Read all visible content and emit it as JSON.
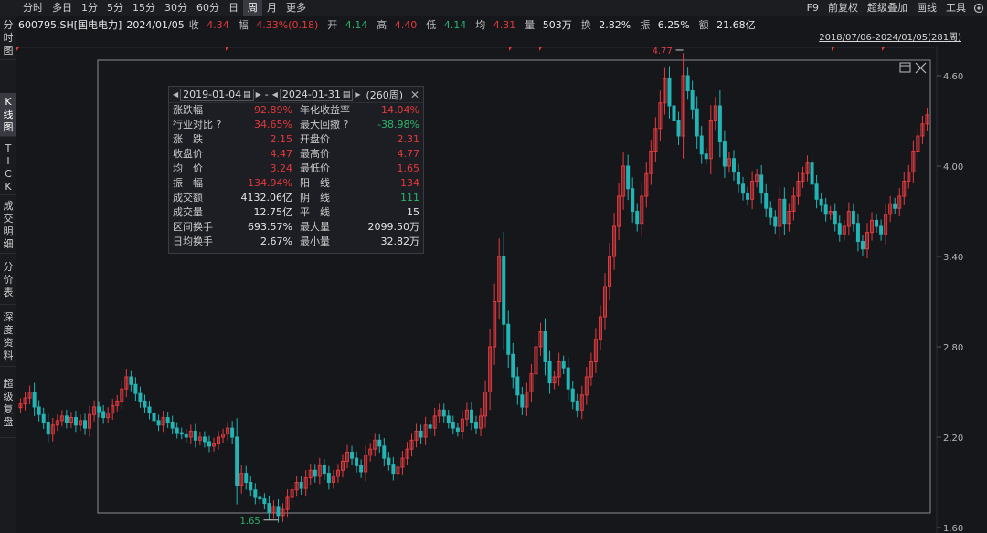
{
  "toolbar": {
    "tabs": [
      {
        "label": "分时",
        "active": false
      },
      {
        "label": "多日",
        "active": false
      },
      {
        "label": "1分",
        "active": false
      },
      {
        "label": "5分",
        "active": false
      },
      {
        "label": "15分",
        "active": false
      },
      {
        "label": "30分",
        "active": false
      },
      {
        "label": "60分",
        "active": false
      },
      {
        "label": "日",
        "active": false
      },
      {
        "label": "周",
        "active": true
      },
      {
        "label": "月",
        "active": false
      },
      {
        "label": "更多",
        "active": false
      }
    ],
    "right_items": [
      "F9",
      "前复权",
      "超级叠加",
      "画线",
      "工具"
    ]
  },
  "quote": {
    "code": "600795.SH[国电电力]",
    "date": "2024/01/05",
    "close_label": "收",
    "close": "4.34",
    "change_label": "幅",
    "change": "4.33%(0.18)",
    "open_label": "开",
    "open": "4.14",
    "high_label": "高",
    "high": "4.40",
    "low_label": "低",
    "low": "4.14",
    "avg_label": "均",
    "avg": "4.31",
    "volume_label": "量",
    "volume": "503万",
    "turnover_label": "换",
    "turnover": "2.82%",
    "amplitude_label": "振",
    "amplitude": "6.25%",
    "amount_label": "额",
    "amount": "21.68亿"
  },
  "sidebar": [
    {
      "chars": [
        "分",
        "时",
        "图"
      ],
      "active": false
    },
    {
      "chars": [
        "K",
        "线",
        "图"
      ],
      "active": true
    },
    {
      "chars": [
        "T",
        "I",
        "C",
        "K"
      ],
      "active": false
    },
    {
      "chars": [
        "成",
        "交",
        "明",
        "细"
      ],
      "active": false
    },
    {
      "chars": [
        "分",
        "价",
        "表"
      ],
      "active": false
    },
    {
      "chars": [
        "深",
        "度",
        "资",
        "料"
      ],
      "active": false
    },
    {
      "chars": [
        "超",
        "级",
        "复",
        "盘"
      ],
      "active": false
    }
  ],
  "range_label": "2018/07/06-2024/01/05(281周)",
  "panel": {
    "start_date": "2019-01-04",
    "separator": "-",
    "end_date": "2024-01-31",
    "weeks": "(260周)",
    "rows": [
      [
        {
          "k": "涨跌幅",
          "v": "92.89%",
          "c": "up"
        },
        {
          "k": "年化收益率",
          "v": "14.04%",
          "c": "up"
        }
      ],
      [
        {
          "k": "行业对比 ?",
          "v": "34.65%",
          "c": "up"
        },
        {
          "k": "最大回撤 ?",
          "v": "-38.98%",
          "c": "down"
        }
      ],
      [
        {
          "k": "涨　跌",
          "v": "2.15",
          "c": "up"
        },
        {
          "k": "开盘价",
          "v": "2.31",
          "c": "up"
        }
      ],
      [
        {
          "k": "收盘价",
          "v": "4.47",
          "c": "up"
        },
        {
          "k": "最高价",
          "v": "4.77",
          "c": "up"
        }
      ],
      [
        {
          "k": "均　价",
          "v": "3.24",
          "c": "up"
        },
        {
          "k": "最低价",
          "v": "1.65",
          "c": "up"
        }
      ],
      [
        {
          "k": "振　幅",
          "v": "134.94%",
          "c": "up"
        },
        {
          "k": "阳　线",
          "v": "134",
          "c": "up"
        }
      ],
      [
        {
          "k": "成交额",
          "v": "4132.06亿",
          "c": "white"
        },
        {
          "k": "阴　线",
          "v": "111",
          "c": "down"
        }
      ],
      [
        {
          "k": "成交量",
          "v": "12.75亿",
          "c": "white"
        },
        {
          "k": "平　线",
          "v": "15",
          "c": "white"
        }
      ],
      [
        {
          "k": "区间换手",
          "v": "693.57%",
          "c": "white"
        },
        {
          "k": "最大量",
          "v": "2099.50万",
          "c": "white"
        }
      ],
      [
        {
          "k": "日均换手",
          "v": "2.67%",
          "c": "white"
        },
        {
          "k": "最小量",
          "v": "32.82万",
          "c": "white"
        }
      ]
    ]
  },
  "chart_data": {
    "type": "candlestick",
    "y_ticks": [
      4.6,
      4.0,
      3.4,
      2.8,
      2.2,
      1.6
    ],
    "ylim": [
      1.6,
      4.8
    ],
    "max_label": "4.77",
    "min_label": "1.65",
    "up_color": "#e23a3f",
    "down_color": "#22b5b5",
    "closes": [
      2.42,
      2.46,
      2.5,
      2.4,
      2.35,
      2.3,
      2.22,
      2.28,
      2.31,
      2.34,
      2.3,
      2.33,
      2.28,
      2.31,
      2.26,
      2.35,
      2.4,
      2.37,
      2.33,
      2.36,
      2.41,
      2.44,
      2.52,
      2.6,
      2.55,
      2.49,
      2.44,
      2.4,
      2.36,
      2.31,
      2.28,
      2.33,
      2.3,
      2.26,
      2.23,
      2.22,
      2.2,
      2.24,
      2.18,
      2.2,
      2.17,
      2.14,
      2.16,
      2.2,
      2.22,
      2.26,
      2.2,
      1.88,
      1.96,
      1.9,
      1.85,
      1.8,
      1.79,
      1.76,
      1.7,
      1.74,
      1.68,
      1.72,
      1.8,
      1.85,
      1.9,
      1.86,
      1.93,
      1.98,
      1.94,
      2.01,
      1.96,
      1.9,
      1.94,
      1.98,
      2.04,
      2.1,
      2.06,
      2.01,
      1.97,
      2.08,
      2.12,
      2.18,
      2.14,
      2.06,
      2.02,
      1.96,
      2.0,
      2.06,
      2.12,
      2.18,
      2.24,
      2.2,
      2.28,
      2.26,
      2.34,
      2.38,
      2.34,
      2.3,
      2.26,
      2.24,
      2.32,
      2.38,
      2.3,
      2.26,
      2.34,
      2.5,
      2.8,
      3.1,
      3.4,
      2.95,
      2.75,
      2.6,
      2.48,
      2.4,
      2.5,
      2.62,
      2.8,
      2.9,
      2.7,
      2.56,
      2.6,
      2.7,
      2.66,
      2.52,
      2.44,
      2.38,
      2.48,
      2.6,
      2.7,
      2.85,
      3.0,
      3.2,
      3.4,
      3.6,
      3.8,
      4.0,
      3.85,
      3.7,
      3.62,
      3.8,
      3.95,
      4.1,
      4.25,
      4.42,
      4.58,
      4.4,
      4.3,
      4.2,
      4.6,
      4.5,
      4.38,
      4.2,
      4.08,
      4.05,
      4.3,
      4.4,
      4.16,
      4.0,
      4.05,
      3.96,
      3.88,
      3.82,
      3.78,
      3.9,
      3.94,
      3.82,
      3.72,
      3.66,
      3.6,
      3.78,
      3.62,
      3.7,
      3.8,
      3.9,
      3.95,
      4.02,
      3.88,
      3.78,
      3.74,
      3.68,
      3.7,
      3.62,
      3.55,
      3.6,
      3.7,
      3.62,
      3.5,
      3.45,
      3.56,
      3.64,
      3.6,
      3.55,
      3.68,
      3.75,
      3.72,
      3.8,
      3.9,
      3.96,
      4.1,
      4.2,
      4.28,
      4.34
    ]
  }
}
